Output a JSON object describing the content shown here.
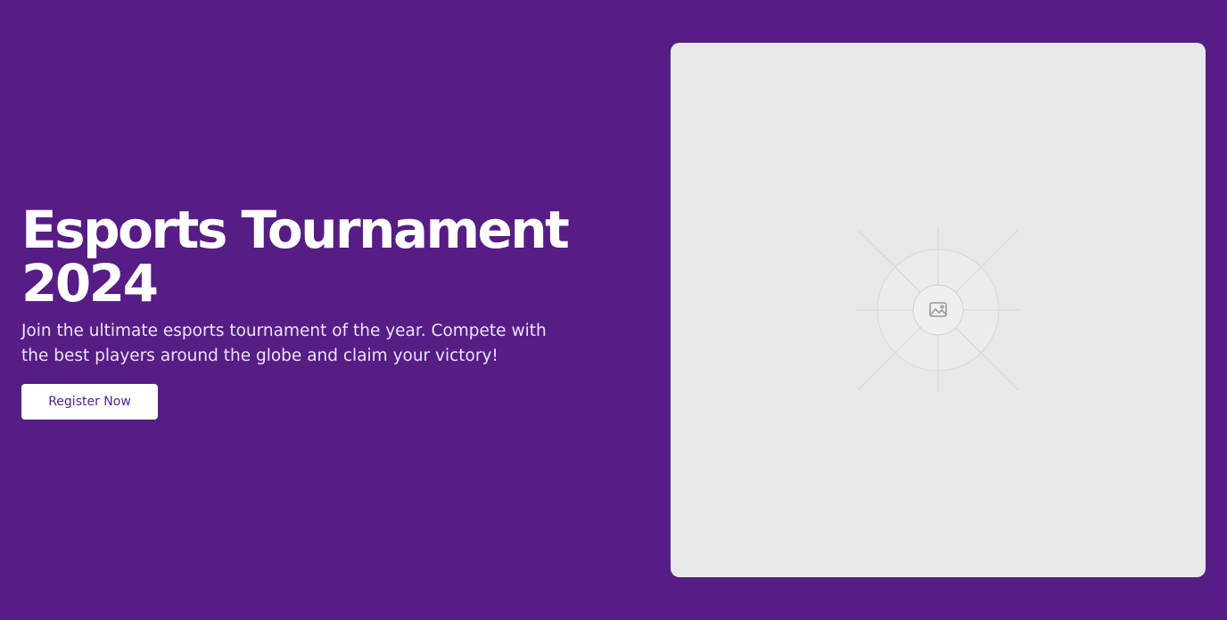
{
  "hero": {
    "title_line1": "Esports Tournament",
    "title_line2": "2024",
    "subtitle": "Join the ultimate esports tournament of the year. Compete with the best players around the globe and claim your victory!",
    "cta_label": "Register Now"
  },
  "image": {
    "icon": "image-placeholder-icon"
  },
  "colors": {
    "background": "#561d85",
    "button_text": "#561d85",
    "panel": "#e8e8e8"
  }
}
